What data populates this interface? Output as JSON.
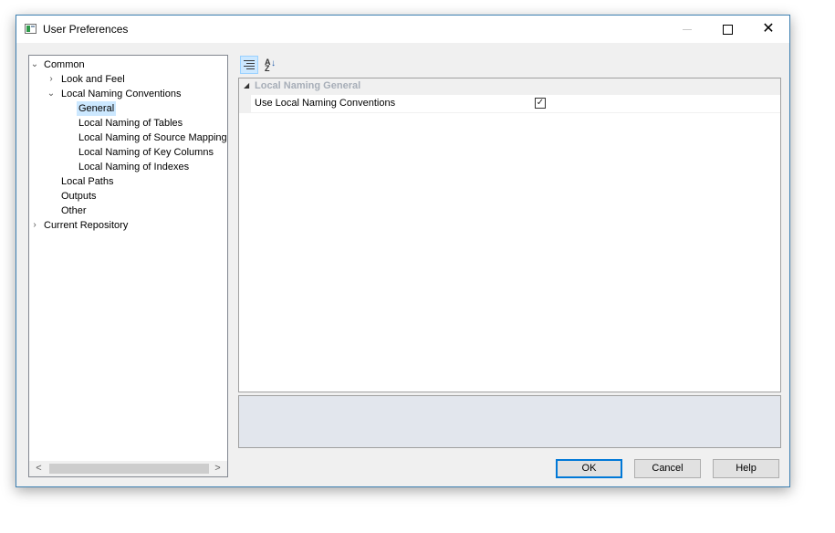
{
  "window": {
    "title": "User Preferences"
  },
  "titlebar": {
    "minimize": "–",
    "maximize": "☐",
    "close": "✕"
  },
  "tree": {
    "items": [
      {
        "label": "Common",
        "expander": "expanded"
      },
      {
        "label": "Look and Feel",
        "expander": "collapsed"
      },
      {
        "label": "Local Naming Conventions",
        "expander": "expanded"
      },
      {
        "label": "General",
        "selected": true
      },
      {
        "label": "Local Naming of Tables"
      },
      {
        "label": "Local Naming of Source Mappings"
      },
      {
        "label": "Local Naming of Key Columns"
      },
      {
        "label": "Local Naming of Indexes"
      },
      {
        "label": "Local Paths"
      },
      {
        "label": "Outputs"
      },
      {
        "label": "Other"
      },
      {
        "label": "Current Repository",
        "expander": "collapsed"
      }
    ],
    "scroll_left": "<",
    "scroll_right": ">"
  },
  "toolbar": {
    "categorized_icon": "categorized-view-icon",
    "alphabetical_icon": "sort-alphabetical-icon",
    "az_a": "A",
    "az_z": "Z",
    "az_arrow": "↓"
  },
  "propgrid": {
    "category": "Local Naming General",
    "category_toggle": "◢",
    "properties": [
      {
        "name": "Use Local Naming Conventions",
        "checked": true,
        "check_glyph": "✓"
      }
    ]
  },
  "buttons": {
    "ok": "OK",
    "cancel": "Cancel",
    "help": "Help"
  },
  "colors": {
    "selection": "#cce8ff",
    "accent": "#0078d7",
    "description_bg": "#e2e6ed"
  }
}
